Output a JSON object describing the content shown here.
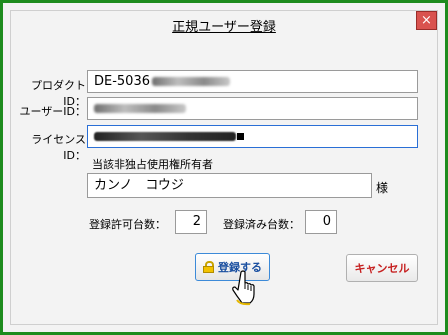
{
  "dialog": {
    "title": "正規ユーザー登録",
    "close_icon": "×"
  },
  "fields": {
    "product_id": {
      "label": "プロダクトID：",
      "value_visible": "DE-5036"
    },
    "user_id": {
      "label": "ユーザーID：",
      "value_visible": ""
    },
    "license_id": {
      "label": "ライセンスID：",
      "value_visible": ""
    },
    "owner": {
      "label": "当該非独占使用権所有者",
      "value": "カンノ　コウジ",
      "suffix": "様"
    }
  },
  "counts": {
    "allowed_label": "登録許可台数：",
    "allowed_value": "2",
    "registered_label": "登録済み台数：",
    "registered_value": "0"
  },
  "buttons": {
    "register": "登録する",
    "cancel": "キャンセル"
  },
  "icons": {
    "close": "close-icon",
    "register": "lock-icon",
    "cursor": "hand-pointer-icon"
  },
  "colors": {
    "frame": "#1e8c1e",
    "close_button": "#d9534f",
    "register_border": "#3c8ad8",
    "cancel_text": "#c62020"
  }
}
